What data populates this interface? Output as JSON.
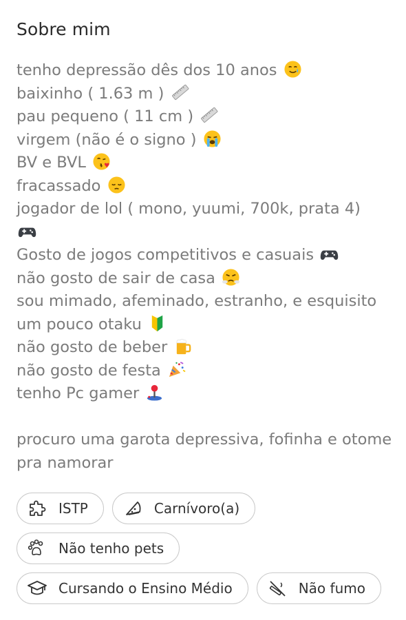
{
  "about": {
    "title": "Sobre mim",
    "lines": [
      {
        "text": "tenho depressão dês dos 10 anos",
        "icon": "smiling-face-with-tear-icon"
      },
      {
        "text": "baixinho ( 1.63 m )",
        "icon": "ruler-icon"
      },
      {
        "text": "pau pequeno ( 11 cm )",
        "icon": "ruler-icon"
      },
      {
        "text": "virgem (não é o signo )",
        "icon": "loudly-crying-face-icon"
      },
      {
        "text": "BV e BVL",
        "icon": "face-blowing-kiss-icon"
      },
      {
        "text": "fracassado",
        "icon": "pensive-face-icon"
      },
      {
        "text": "jogador de lol ( mono, yuumi, 700k, prata 4)",
        "icon": "video-game-icon"
      },
      {
        "text": "Gosto de jogos competitivos e casuais",
        "icon": "video-game-icon"
      },
      {
        "text": "não gosto de sair de casa",
        "icon": "face-with-steam-icon"
      },
      {
        "text": "sou mimado, afeminado, estranho, e esquisito",
        "icon": ""
      },
      {
        "text": "um pouco otaku",
        "icon": "japanese-beginner-symbol-icon"
      },
      {
        "text": "não gosto de beber",
        "icon": "beer-mug-icon"
      },
      {
        "text": "não gosto de festa",
        "icon": "party-popper-icon"
      },
      {
        "text": "tenho Pc gamer",
        "icon": "joystick-icon"
      }
    ],
    "closing": "procuro uma garota depressiva, fofinha e otome pra namorar"
  },
  "chips": [
    {
      "label": "ISTP",
      "icon": "puzzle-icon"
    },
    {
      "label": "Carnívoro(a)",
      "icon": "pizza-slice-icon"
    },
    {
      "label": "Não tenho pets",
      "icon": "paw-icon"
    },
    {
      "label": "Cursando o Ensino Médio",
      "icon": "graduation-cap-icon"
    },
    {
      "label": "Não fumo",
      "icon": "no-smoking-icon"
    }
  ],
  "colors": {
    "title": "#2a2a2a",
    "bio_text": "#7b7b7b",
    "chip_border": "#c9c9c9",
    "chip_text": "#333333"
  }
}
